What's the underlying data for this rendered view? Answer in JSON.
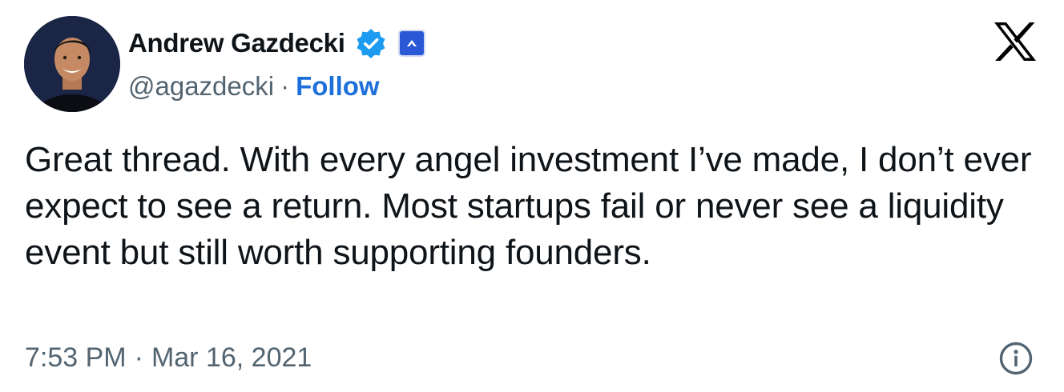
{
  "author": {
    "name": "Andrew Gazdecki",
    "handle": "@agazdecki",
    "separator": "·",
    "follow_label": "Follow",
    "avatar_icon": "profile-photo",
    "verified_icon": "verified-badge-icon",
    "affiliate_icon": "affiliate-badge-icon"
  },
  "platform": {
    "logo_icon": "x-logo-icon"
  },
  "tweet": {
    "text": "Great thread. With every angel investment I’ve made, I don’t ever expect to see a return. Most startups fail or never see a liquidity event but still worth supporting founders."
  },
  "meta": {
    "time": "7:53 PM",
    "separator": "·",
    "date": "Mar 16, 2021",
    "info_icon": "info-icon"
  },
  "colors": {
    "text_primary": "#0f1419",
    "text_secondary": "#536471",
    "link": "#1d6fd9",
    "verified": "#1d9bf0",
    "affiliate": "#2b59d6"
  }
}
